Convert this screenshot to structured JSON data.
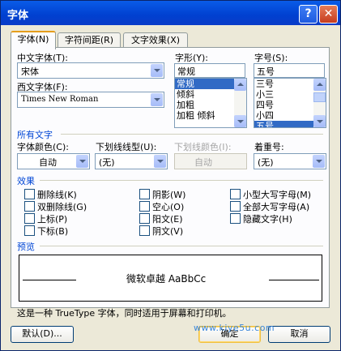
{
  "window": {
    "title": "字体",
    "help_glyph": "?",
    "close_glyph": "✕"
  },
  "tabs": [
    {
      "label": "字体(N)"
    },
    {
      "label": "字符间距(R)"
    },
    {
      "label": "文字效果(X)"
    }
  ],
  "font": {
    "chinese_label": "中文字体(T):",
    "chinese_value": "宋体",
    "western_label": "西文字体(F):",
    "western_value": "Times New Roman",
    "style_label": "字形(Y):",
    "style_value": "常规",
    "style_options": [
      "常规",
      "倾斜",
      "加粗",
      "加粗 倾斜"
    ],
    "size_label": "字号(S):",
    "size_value": "五号",
    "size_options": [
      "三号",
      "小三",
      "四号",
      "小四",
      "五号"
    ]
  },
  "all_text": {
    "section_label": "所有文字",
    "color_label": "字体颜色(C):",
    "color_value": "自动",
    "underline_label": "下划线线型(U):",
    "underline_value": "(无)",
    "underline_color_label": "下划线颜色(I):",
    "underline_color_value": "自动",
    "emphasis_label": "着重号:",
    "emphasis_value": "(无)"
  },
  "effects": {
    "section_label": "效果",
    "items": [
      {
        "label": "删除线(K)"
      },
      {
        "label": "双删除线(G)"
      },
      {
        "label": "上标(P)"
      },
      {
        "label": "下标(B)"
      },
      {
        "label": "阴影(W)"
      },
      {
        "label": "空心(O)"
      },
      {
        "label": "阳文(E)"
      },
      {
        "label": "阴文(V)"
      },
      {
        "label": "小型大写字母(M)"
      },
      {
        "label": "全部大写字母(A)"
      },
      {
        "label": "隐藏文字(H)"
      }
    ]
  },
  "preview": {
    "section_label": "预览",
    "sample_text": "微软卓越 AaBbCc",
    "note": "这是一种 TrueType 字体，同时适用于屏幕和打印机。"
  },
  "buttons": {
    "default_label": "默认(D)...",
    "ok_label": "确定",
    "cancel_label": "取消"
  },
  "watermark": "www.kiye5u.com"
}
